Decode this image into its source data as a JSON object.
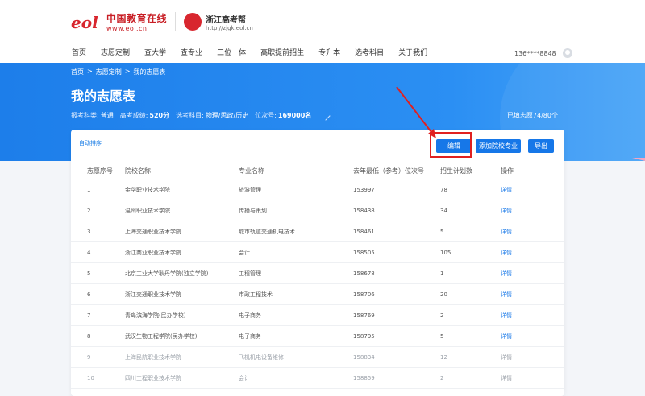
{
  "header": {
    "brand_logo_text": "eol",
    "brand_name": "中国教育在线",
    "brand_url": "www.eol.cn",
    "partner_logo_text": "浙江高考帮",
    "partner_name": "浙江高考帮",
    "partner_url": "http://zjgk.eol.cn",
    "nav": [
      "首页",
      "志愿定制",
      "查大学",
      "查专业",
      "三位一体",
      "高职提前招生",
      "专升本",
      "选考科目",
      "关于我们"
    ],
    "user_phone": "136****8848"
  },
  "banner": {
    "breadcrumb": [
      "首页",
      ">",
      "志愿定制",
      ">",
      "我的志愿表"
    ],
    "title": "我的志愿表",
    "info": {
      "type_label": "报考科类:",
      "type_value": "普通",
      "score_label": "高考成绩:",
      "score_value": "520分",
      "subjects_label": "选考科目:",
      "subjects_value": "物理/思政/历史",
      "rank_label": "位次号:",
      "rank_value": "169000名"
    },
    "filled": "已填志愿74/80个"
  },
  "card": {
    "auto_sort": "自动排序",
    "btn_edit": "编辑",
    "btn_add": "添加院校专业",
    "btn_export": "导出",
    "columns": [
      "志愿序号",
      "院校名称",
      "专业名称",
      "去年最低（参考）位次号",
      "招生计划数",
      "操作"
    ],
    "rows": [
      {
        "no": "1",
        "school": "金华职业技术学院",
        "major": "旅游管理",
        "rank": "153997",
        "plan": "78",
        "op": "详情"
      },
      {
        "no": "2",
        "school": "温州职业技术学院",
        "major": "传播与策划",
        "rank": "158438",
        "plan": "34",
        "op": "详情"
      },
      {
        "no": "3",
        "school": "上海交通职业技术学院",
        "major": "城市轨道交通机电技术",
        "rank": "158461",
        "plan": "5",
        "op": "详情"
      },
      {
        "no": "4",
        "school": "浙江商业职业技术学院",
        "major": "会计",
        "rank": "158505",
        "plan": "105",
        "op": "详情"
      },
      {
        "no": "5",
        "school": "北京工业大学耿丹学院(独立学院)",
        "major": "工程管理",
        "rank": "158678",
        "plan": "1",
        "op": "详情"
      },
      {
        "no": "6",
        "school": "浙江交通职业技术学院",
        "major": "市政工程技术",
        "rank": "158706",
        "plan": "20",
        "op": "详情"
      },
      {
        "no": "7",
        "school": "青岛滨海学院(民办学校)",
        "major": "电子商务",
        "rank": "158769",
        "plan": "2",
        "op": "详情"
      },
      {
        "no": "8",
        "school": "武汉生物工程学院(民办学校)",
        "major": "电子商务",
        "rank": "158795",
        "plan": "5",
        "op": "详情"
      },
      {
        "no": "9",
        "school": "上海民航职业技术学院",
        "major": "飞机机电设备维修",
        "rank": "158834",
        "plan": "12",
        "op": "详情"
      },
      {
        "no": "10",
        "school": "四川工程职业技术学院",
        "major": "会计",
        "rank": "158859",
        "plan": "2",
        "op": "详情"
      }
    ]
  },
  "colors": {
    "accent": "#1677e8",
    "banner": "#2b8ff3",
    "highlight": "#e02020"
  }
}
